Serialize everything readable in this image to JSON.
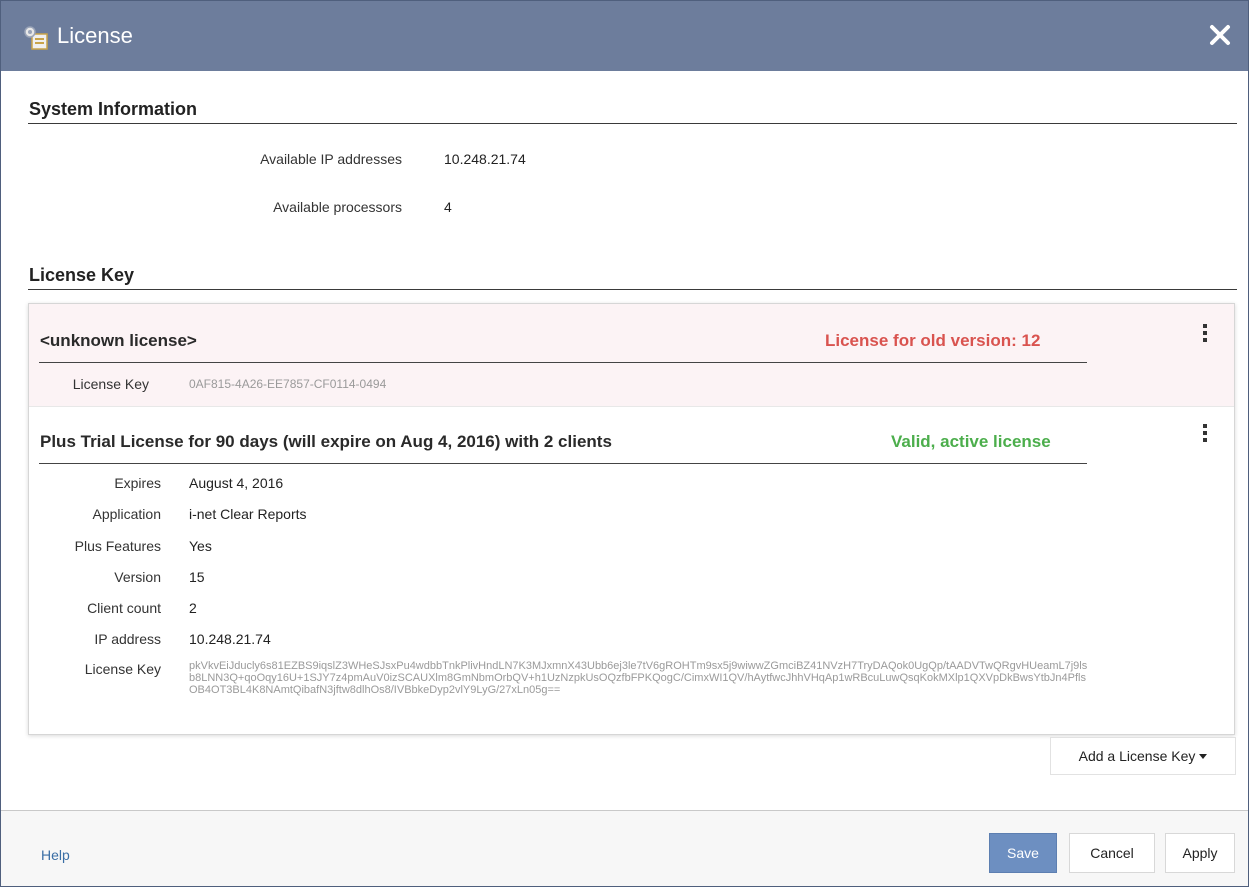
{
  "window": {
    "title": "License"
  },
  "system_info": {
    "heading": "System Information",
    "rows": [
      {
        "label": "Available IP addresses",
        "value": "10.248.21.74"
      },
      {
        "label": "Available processors",
        "value": "4"
      }
    ]
  },
  "license_key_section": {
    "heading": "License Key"
  },
  "licenses": [
    {
      "title": "<unknown license>",
      "status": "License for old version: 12",
      "status_color": "#d9534f",
      "fields": [
        {
          "label": "License Key",
          "value": "0AF815-4A26-EE7857-CF0114-0494"
        }
      ]
    },
    {
      "title": "Plus Trial License for 90 days (will expire on Aug 4, 2016) with 2 clients",
      "status": "Valid, active license",
      "status_color": "#4cae4c",
      "fields": [
        {
          "label": "Expires",
          "value": "August 4, 2016"
        },
        {
          "label": "Application",
          "value": "i-net Clear Reports"
        },
        {
          "label": "Plus Features",
          "value": "Yes"
        },
        {
          "label": "Version",
          "value": "15"
        },
        {
          "label": "Client count",
          "value": "2"
        },
        {
          "label": "IP address",
          "value": "10.248.21.74"
        }
      ],
      "key_label": "License Key",
      "key_value": "pkVkvEiJducly6s81EZBS9iqslZ3WHeSJsxPu4wdbbTnkPlivHndLN7K3MJxmnX43Ubb6ej3le7tV6gROHTm9sx5j9wiwwZGmciBZ41NVzH7TryDAQok0UgQp/tAADVTwQRgvHUeamL7j9lsb8LNN3Q+qoOqy16U+1SJY7z4pmAuV0izSCAUXlm8GmNbmOrbQV+h1UzNzpkUsOQzfbFPKQogC/CimxWI1QV/hAytfwcJhhVHqAp1wRBcuLuwQsqKokMXlp1QXVpDkBwsYtbJn4PflsOB4OT3BL4K8NAmtQibafN3jftw8dlhOs8/IVBbkeDyp2vlY9LyG/27xLn05g=="
    }
  ],
  "add_license_button": "Add a License Key",
  "footer": {
    "help": "Help",
    "save": "Save",
    "cancel": "Cancel",
    "apply": "Apply"
  }
}
